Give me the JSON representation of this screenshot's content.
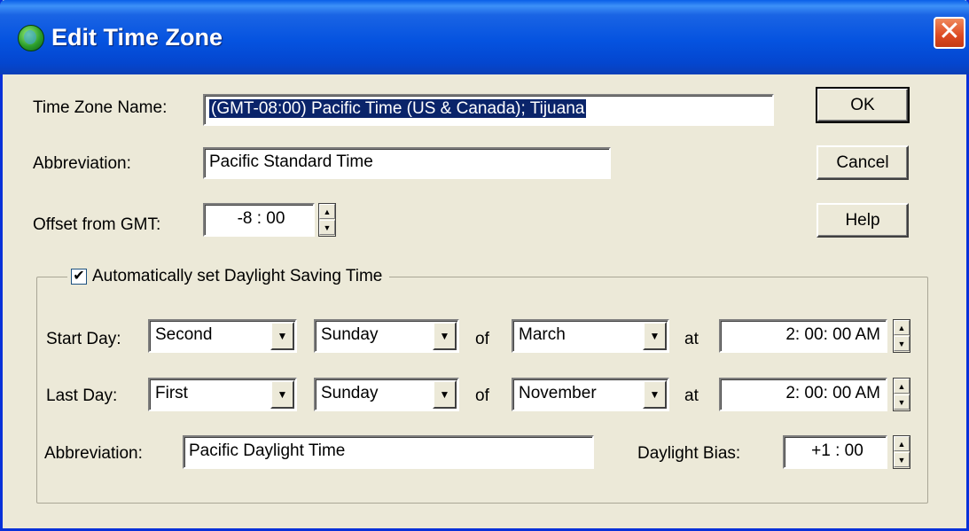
{
  "window": {
    "title": "Edit Time Zone",
    "close_glyph": "✕"
  },
  "icons": {
    "title": "globe-icon",
    "spin_up": "▲",
    "spin_down": "▼",
    "dropdown": "▼",
    "check": "✔"
  },
  "fields": {
    "tz_name_label": "Time Zone Name:",
    "tz_name_value": "(GMT-08:00) Pacific Time (US & Canada); Tijuana",
    "abbr_label": "Abbreviation:",
    "abbr_value": "Pacific Standard Time",
    "offset_label": "Offset from GMT:",
    "offset_value": "-8 : 00"
  },
  "buttons": {
    "ok": "OK",
    "cancel": "Cancel",
    "help": "Help"
  },
  "dst": {
    "checkbox_label": "Automatically set Daylight Saving Time",
    "checked": true,
    "start_label": "Start Day:",
    "start_week": "Second",
    "start_day": "Sunday",
    "of_label": "of",
    "start_month": "March",
    "at_label": "at",
    "start_time": "2: 00: 00 AM",
    "last_label": "Last Day:",
    "last_week": "First",
    "last_day": "Sunday",
    "last_month": "November",
    "last_time": "2: 00: 00 AM",
    "abbr_label": "Abbreviation:",
    "abbr_value": "Pacific Daylight Time",
    "bias_label": "Daylight Bias:",
    "bias_value": "+1 : 00"
  }
}
